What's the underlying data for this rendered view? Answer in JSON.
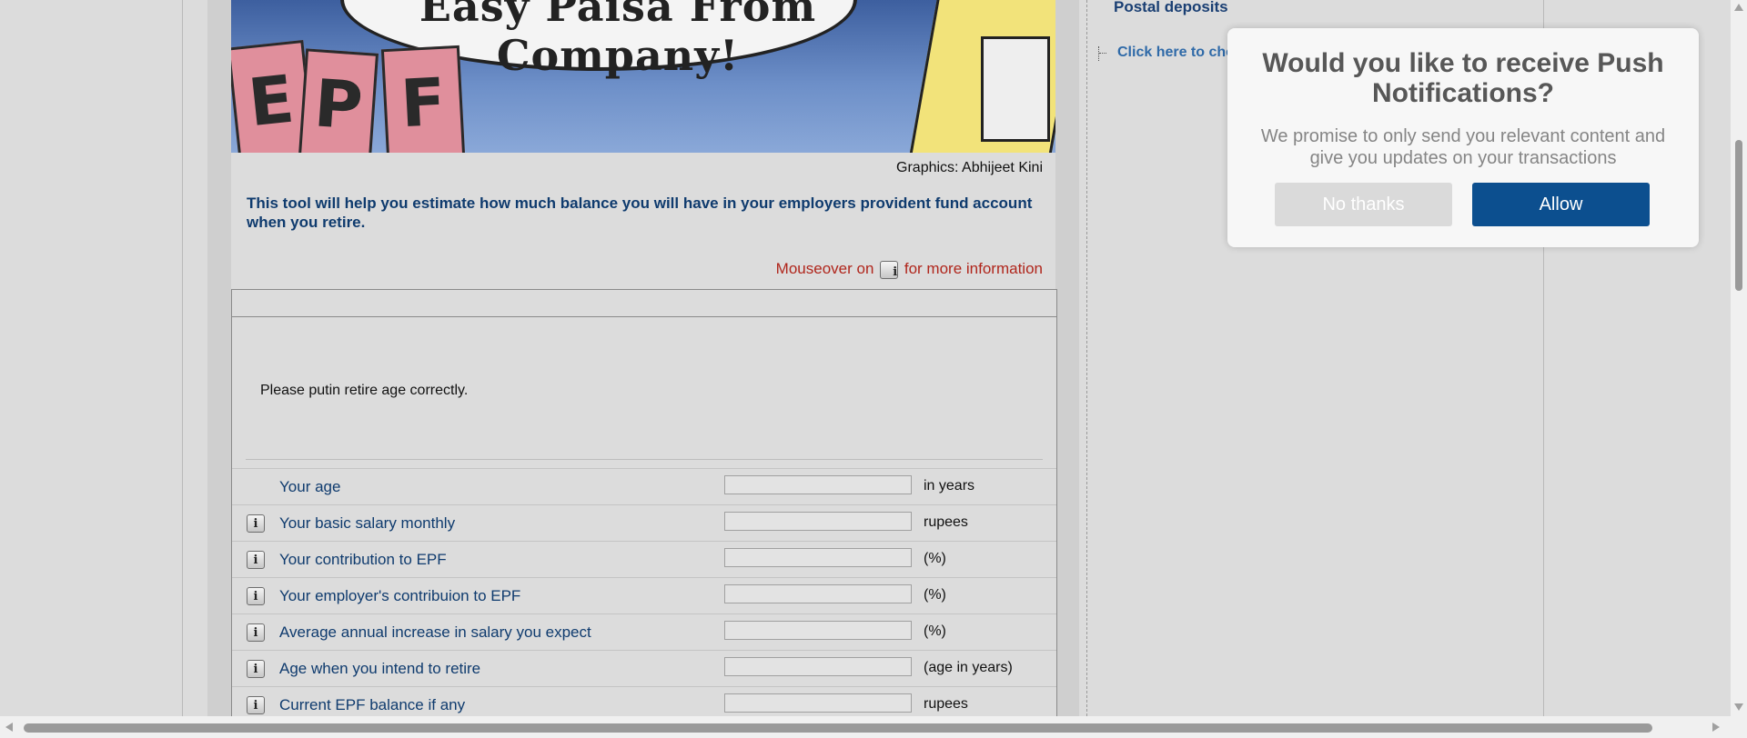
{
  "banner": {
    "speech_text": "Easy Paisa From Company!",
    "card_letters": [
      "E",
      "P",
      "F"
    ]
  },
  "credit": "Graphics: Abhijeet Kini",
  "intro": "This tool will help you estimate how much balance you will have in your employers provident fund account when you retire.",
  "mouseover": {
    "prefix": "Mouseover on",
    "suffix": "for more information",
    "icon": "info-icon"
  },
  "form": {
    "message": "Please putin retire age correctly.",
    "rows": [
      {
        "label": "Your age",
        "unit": "in years",
        "value": "",
        "has_info": false
      },
      {
        "label": "Your basic salary monthly",
        "unit": "rupees",
        "value": "",
        "has_info": true
      },
      {
        "label": "Your contribution to EPF",
        "unit": "(%)",
        "value": "",
        "has_info": true
      },
      {
        "label": "Your employer's contribuion to EPF",
        "unit": "(%)",
        "value": "",
        "has_info": true
      },
      {
        "label": "Average annual increase in salary you expect",
        "unit": "(%)",
        "value": "",
        "has_info": true
      },
      {
        "label": "Age when you intend to retire",
        "unit": "(age in years)",
        "value": "",
        "has_info": true
      },
      {
        "label": "Current EPF balance if any",
        "unit": "rupees",
        "value": "",
        "has_info": true
      }
    ]
  },
  "sidebar": {
    "heading": "Postal deposits",
    "link": "Click here to che"
  },
  "modal": {
    "title": "Would you like to receive Push Notifications?",
    "subtitle": "We promise to only send you relevant content and give you updates on your transactions",
    "no_label": "No thanks",
    "allow_label": "Allow",
    "allow_color": "#0c4f8f"
  },
  "info_icon_glyph": "i"
}
